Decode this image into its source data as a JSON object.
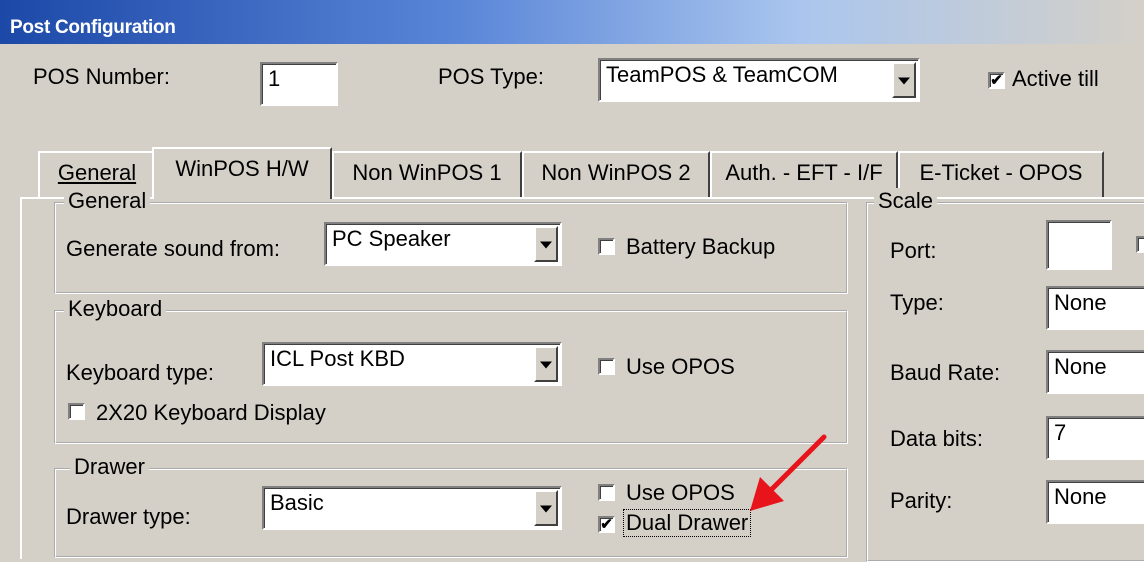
{
  "window": {
    "title": "Post Configuration"
  },
  "header": {
    "pos_number_label": "POS Number:",
    "pos_number_value": "1",
    "pos_type_label": "POS Type:",
    "pos_type_value": "TeamPOS & TeamCOM",
    "active_till_label": "Active till",
    "active_till_checked": "✔"
  },
  "tabs": [
    {
      "label": "General",
      "active": false
    },
    {
      "label": "WinPOS H/W",
      "active": true
    },
    {
      "label": "Non WinPOS 1",
      "active": false
    },
    {
      "label": "Non WinPOS 2",
      "active": false
    },
    {
      "label": "Auth. - EFT - I/F",
      "active": false
    },
    {
      "label": "E-Ticket - OPOS",
      "active": false
    }
  ],
  "general_group": {
    "title": "General",
    "sound_label": "Generate sound from:",
    "sound_value": "PC Speaker",
    "battery_backup_label": "Battery Backup"
  },
  "keyboard_group": {
    "title": "Keyboard",
    "type_label": "Keyboard type:",
    "type_value": "ICL Post KBD",
    "use_opos_label": "Use OPOS",
    "display_label": "2X20 Keyboard Display"
  },
  "drawer_group": {
    "title": "Drawer",
    "type_label": "Drawer type:",
    "type_value": "Basic",
    "use_opos_label": "Use OPOS",
    "dual_drawer_label": "Dual Drawer",
    "dual_drawer_checked": "✔"
  },
  "scale_group": {
    "title": "Scale",
    "port_label": "Port:",
    "port_value": "",
    "type_label": "Type:",
    "type_value": "None",
    "baud_label": "Baud Rate:",
    "baud_value": "None",
    "databits_label": "Data bits:",
    "databits_value": "7",
    "parity_label": "Parity:",
    "parity_value": "None"
  },
  "annotation": {
    "arrow_color": "#e8141b"
  }
}
